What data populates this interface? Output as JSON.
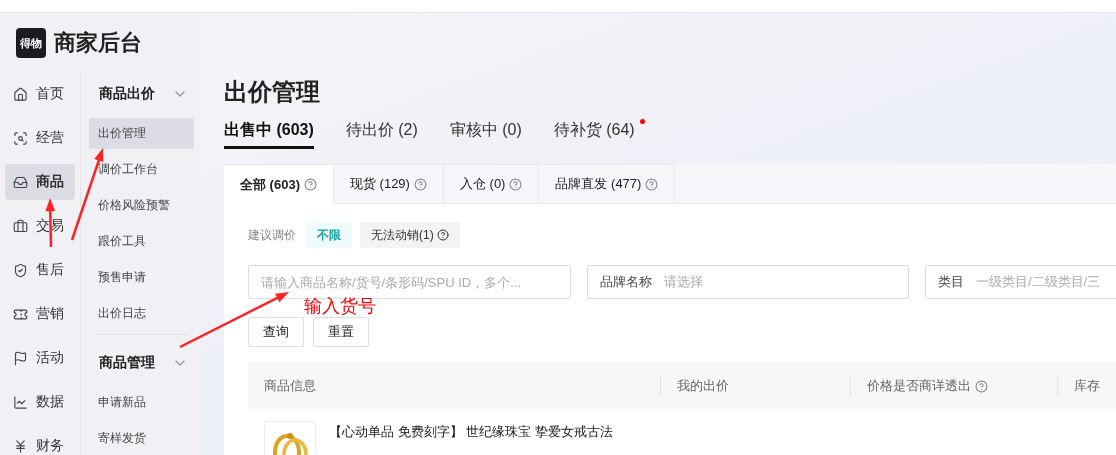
{
  "logo": {
    "badge": "得物",
    "title": "商家后台"
  },
  "primary_nav": [
    {
      "label": "首页",
      "selected": false
    },
    {
      "label": "经营",
      "selected": false
    },
    {
      "label": "商品",
      "selected": true
    },
    {
      "label": "交易",
      "selected": false
    },
    {
      "label": "售后",
      "selected": false
    },
    {
      "label": "营销",
      "selected": false
    },
    {
      "label": "活动",
      "selected": false
    },
    {
      "label": "数据",
      "selected": false
    },
    {
      "label": "财务",
      "selected": false
    }
  ],
  "secondary_nav": [
    {
      "title": "商品出价",
      "expanded": true,
      "items": [
        {
          "label": "出价管理",
          "selected": true
        },
        {
          "label": "调价工作台",
          "selected": false
        },
        {
          "label": "价格风险预警",
          "selected": false
        },
        {
          "label": "跟价工具",
          "selected": false
        },
        {
          "label": "预售申请",
          "selected": false
        },
        {
          "label": "出价日志",
          "selected": false
        }
      ]
    },
    {
      "title": "商品管理",
      "expanded": true,
      "items": [
        {
          "label": "申请新品",
          "selected": false
        },
        {
          "label": "寄样发货",
          "selected": false
        }
      ]
    }
  ],
  "page_title": "出价管理",
  "status_tabs": [
    {
      "label": "出售中 (603)",
      "selected": true,
      "dot": false
    },
    {
      "label": "待出价 (2)",
      "selected": false,
      "dot": false
    },
    {
      "label": "审核中 (0)",
      "selected": false,
      "dot": false
    },
    {
      "label": "待补货 (64)",
      "selected": false,
      "dot": true
    }
  ],
  "sub_tabs": [
    {
      "label": "全部 (603)",
      "selected": true
    },
    {
      "label": "现货 (129)",
      "selected": false
    },
    {
      "label": "入仓 (0)",
      "selected": false
    },
    {
      "label": "品牌直发 (477)",
      "selected": false
    }
  ],
  "filter": {
    "label": "建议调价",
    "options": [
      {
        "label": "不限",
        "selected": true,
        "help": false
      },
      {
        "label": "无法动销(1)",
        "selected": false,
        "help": true
      }
    ]
  },
  "search_field": {
    "placeholder": "请输入商品名称/货号/条形码/SPU ID，多个..."
  },
  "select_fields": [
    {
      "label": "品牌名称",
      "placeholder": "请选择"
    },
    {
      "label": "类目",
      "placeholder": "一级类目/二级类目/三"
    }
  ],
  "buttons": [
    "查询",
    "重置"
  ],
  "table": {
    "columns": [
      {
        "label": "商品信息",
        "help": false
      },
      {
        "label": "我的出价",
        "help": false
      },
      {
        "label": "价格是否商详透出",
        "help": true
      },
      {
        "label": "库存",
        "help": false
      }
    ],
    "rows": [
      {
        "kind": "picture",
        "title": "【心动单品 免费刻字】 世纪缘珠宝 挚爱女戒古法"
      }
    ]
  },
  "annotation": {
    "text": "输入货号"
  }
}
